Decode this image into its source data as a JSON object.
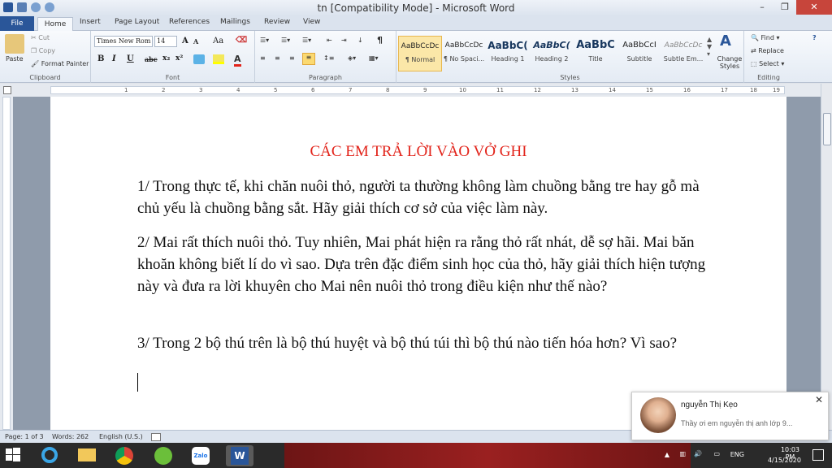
{
  "window": {
    "title": "tn [Compatibility Mode] - Microsoft Word",
    "min": "–",
    "max": "❐",
    "close": "✕"
  },
  "tabs": [
    "File",
    "Home",
    "Insert",
    "Page Layout",
    "References",
    "Mailings",
    "Review",
    "View"
  ],
  "clipboard": {
    "paste": "Paste",
    "cut": "Cut",
    "copy": "Copy",
    "format_painter": "Format Painter",
    "label": "Clipboard"
  },
  "font": {
    "name": "Times New Rom",
    "size": "14",
    "label": "Font",
    "grow": "A",
    "shrink": "A",
    "case": "Aa",
    "bold": "B",
    "italic": "I",
    "underline": "U",
    "strike": "abc",
    "sub": "x₂",
    "sup": "x²"
  },
  "paragraph": {
    "label": "Paragraph",
    "pilcrow": "¶"
  },
  "styles": {
    "label": "Styles",
    "items": [
      {
        "preview": "AaBbCcDc",
        "name": "¶ Normal"
      },
      {
        "preview": "AaBbCcDc",
        "name": "¶ No Spaci..."
      },
      {
        "preview": "AaBbC(",
        "name": "Heading 1"
      },
      {
        "preview": "AaBbC(",
        "name": "Heading 2"
      },
      {
        "preview": "AaBbC",
        "name": "Title"
      },
      {
        "preview": "AaBbCcI",
        "name": "Subtitle"
      },
      {
        "preview": "AaBbCcDc",
        "name": "Subtle Em..."
      }
    ],
    "change": "Change Styles"
  },
  "editing": {
    "label": "Editing",
    "find": "Find",
    "replace": "Replace",
    "select": "Select"
  },
  "ruler": [
    "1",
    "2",
    "3",
    "4",
    "5",
    "6",
    "7",
    "8",
    "9",
    "10",
    "11",
    "12",
    "13",
    "14",
    "15",
    "16",
    "17",
    "18",
    "19"
  ],
  "document": {
    "title": "CÁC EM TRẢ LỜI VÀO VỞ GHI",
    "paragraphs": [
      "1/ Trong thực tế, khi chăn nuôi thỏ, người ta thường không làm chuồng bằng tre hay gỗ mà chủ yếu là chuồng bằng sắt. Hãy giải thích cơ sở của việc làm này.",
      "2/ Mai rất thích nuôi thỏ. Tuy nhiên, Mai phát hiện ra rằng thỏ rất nhát, dễ sợ hãi. Mai băn khoăn không biết lí do vì sao. Dựa trên đặc điểm sinh học của thỏ, hãy giải thích hiện tượng này và đưa ra lời khuyên cho Mai nên nuôi thỏ trong điều kiện như thế nào?",
      "3/ Trong 2 bộ thú trên là bộ thú huyệt và bộ thú túi thì bộ thú nào tiến hóa hơn? Vì sao?"
    ]
  },
  "status": {
    "page": "Page: 1 of 3",
    "words": "Words: 262",
    "lang": "English (U.S.)"
  },
  "toast": {
    "name": "nguyễn Thị Kẹo",
    "message": "Thầy ơi em nguyễn thị anh lớp 9...",
    "close": "✕"
  },
  "tray": {
    "lang": "ENG",
    "time": "10:03 PM",
    "date": "4/15/2020"
  },
  "taskbar": {
    "zalo": "Zalo"
  },
  "colors": {
    "accent": "#2a5699",
    "doc_title": "#e2231a"
  }
}
